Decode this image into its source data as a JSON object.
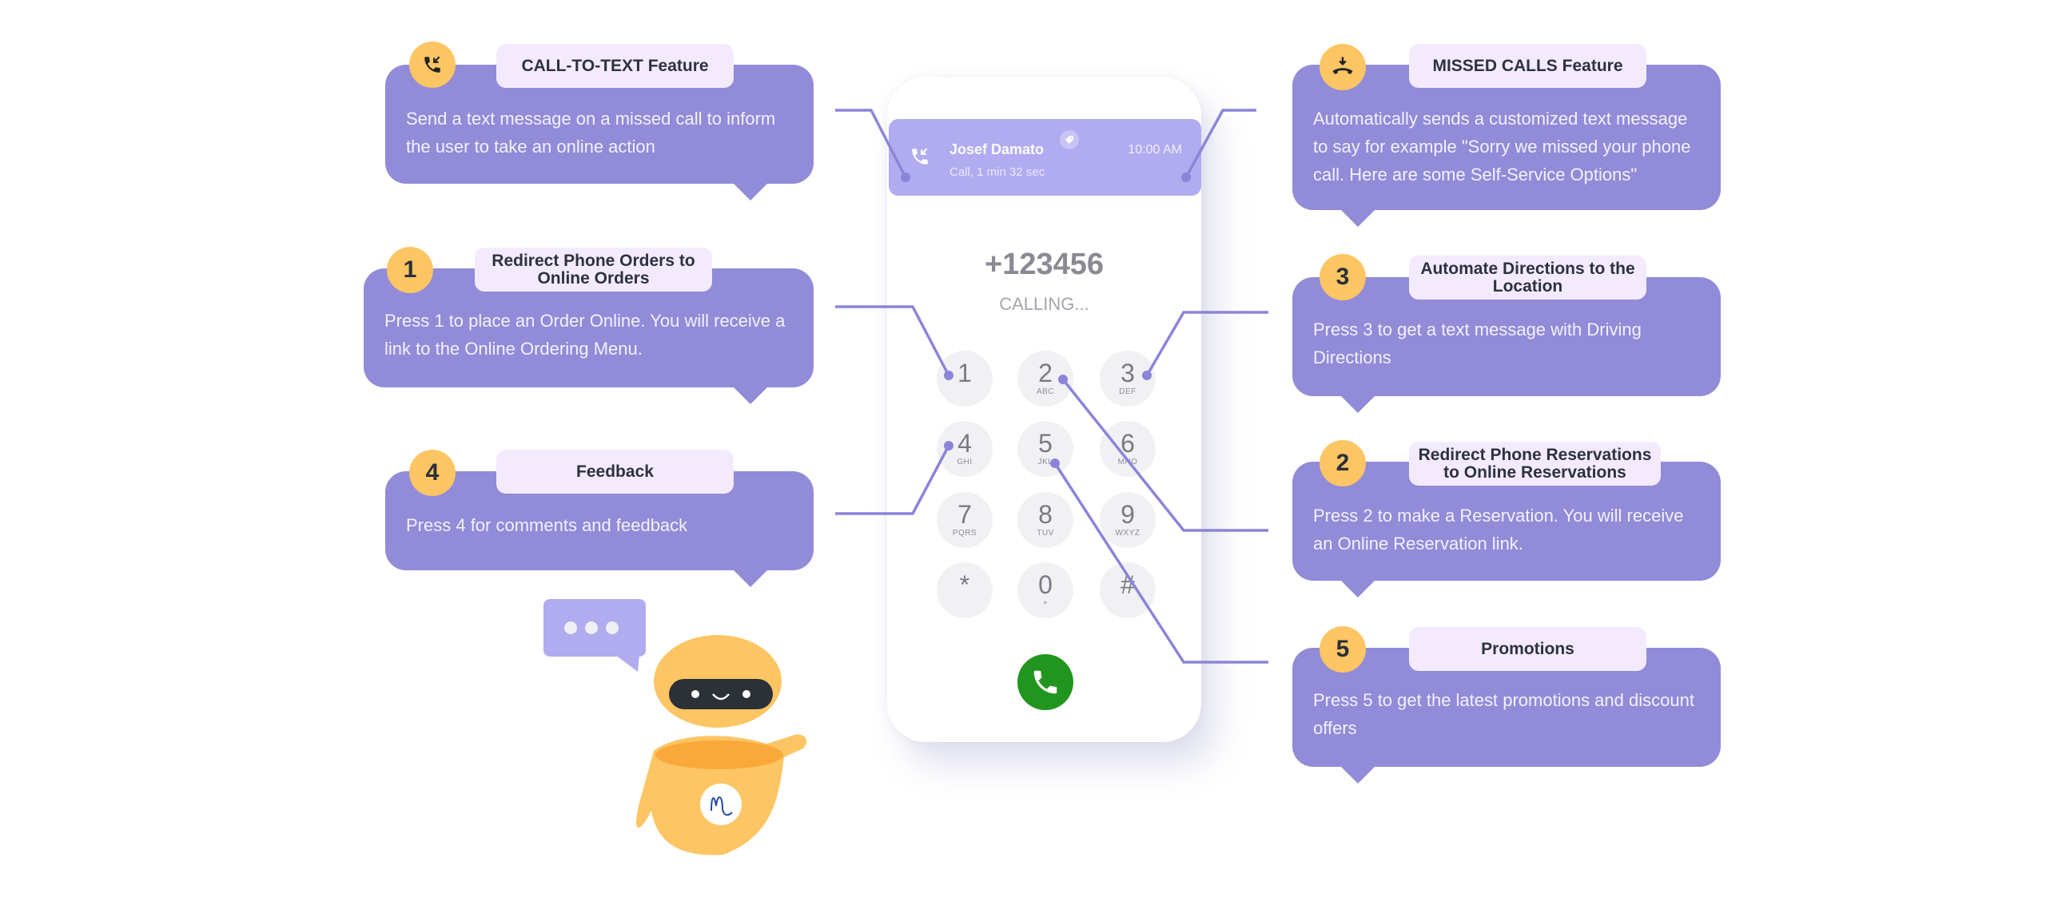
{
  "colors": {
    "card": "#928bd8",
    "badge": "#fdc563",
    "title_bg": "#f3ebfd",
    "connector": "#8c84d8",
    "call_green": "#22951f",
    "notification": "#b1abf0"
  },
  "cards": [
    {
      "id": "call-to-text",
      "badge_icon": "incoming-call-icon",
      "title": "CALL-TO-TEXT Feature",
      "body": "Send a text message on a missed call to inform the user to take an online action"
    },
    {
      "id": "redirect-orders",
      "badge": "1",
      "title": "Redirect  Phone Orders to Online Orders",
      "body": "Press 1 to place an Order Online. You will receive a link to the Online Ordering Menu."
    },
    {
      "id": "feedback",
      "badge": "4",
      "title": "Feedback",
      "body": "Press 4 for comments and feedback"
    },
    {
      "id": "missed-calls",
      "badge_icon": "missed-call-icon",
      "title": "MISSED CALLS Feature",
      "body": "Automatically sends a customized text message to say for example \"Sorry we missed your phone call. Here are some Self-Service Options\""
    },
    {
      "id": "directions",
      "badge": "3",
      "title": "Automate Directions to the Location",
      "body": "Press 3 to get a text message with Driving Directions"
    },
    {
      "id": "reservations",
      "badge": "2",
      "title": "Redirect Phone Reservations to Online Reservations",
      "body": "Press 2 to make a Reservation. You will receive an Online Reservation link."
    },
    {
      "id": "promotions",
      "badge": "5",
      "title": "Promotions",
      "body": "Press 5 to get the latest promotions and discount offers"
    }
  ],
  "phone": {
    "notification": {
      "name": "Josef Damato",
      "detail": "Call, 1 min 32 sec",
      "time": "10:00 AM"
    },
    "number": "+123456",
    "status": "CALLING...",
    "keys": [
      {
        "digit": "1",
        "letters": ""
      },
      {
        "digit": "2",
        "letters": "ABC"
      },
      {
        "digit": "3",
        "letters": "DEF"
      },
      {
        "digit": "4",
        "letters": "GHI"
      },
      {
        "digit": "5",
        "letters": "JKL"
      },
      {
        "digit": "6",
        "letters": "MNO"
      },
      {
        "digit": "7",
        "letters": "PQRS"
      },
      {
        "digit": "8",
        "letters": "TUV"
      },
      {
        "digit": "9",
        "letters": "WXYZ"
      },
      {
        "digit": "*",
        "letters": ""
      },
      {
        "digit": "0",
        "letters": "+"
      },
      {
        "digit": "#",
        "letters": ""
      }
    ]
  },
  "mascot": {
    "logo_letter": "m"
  }
}
